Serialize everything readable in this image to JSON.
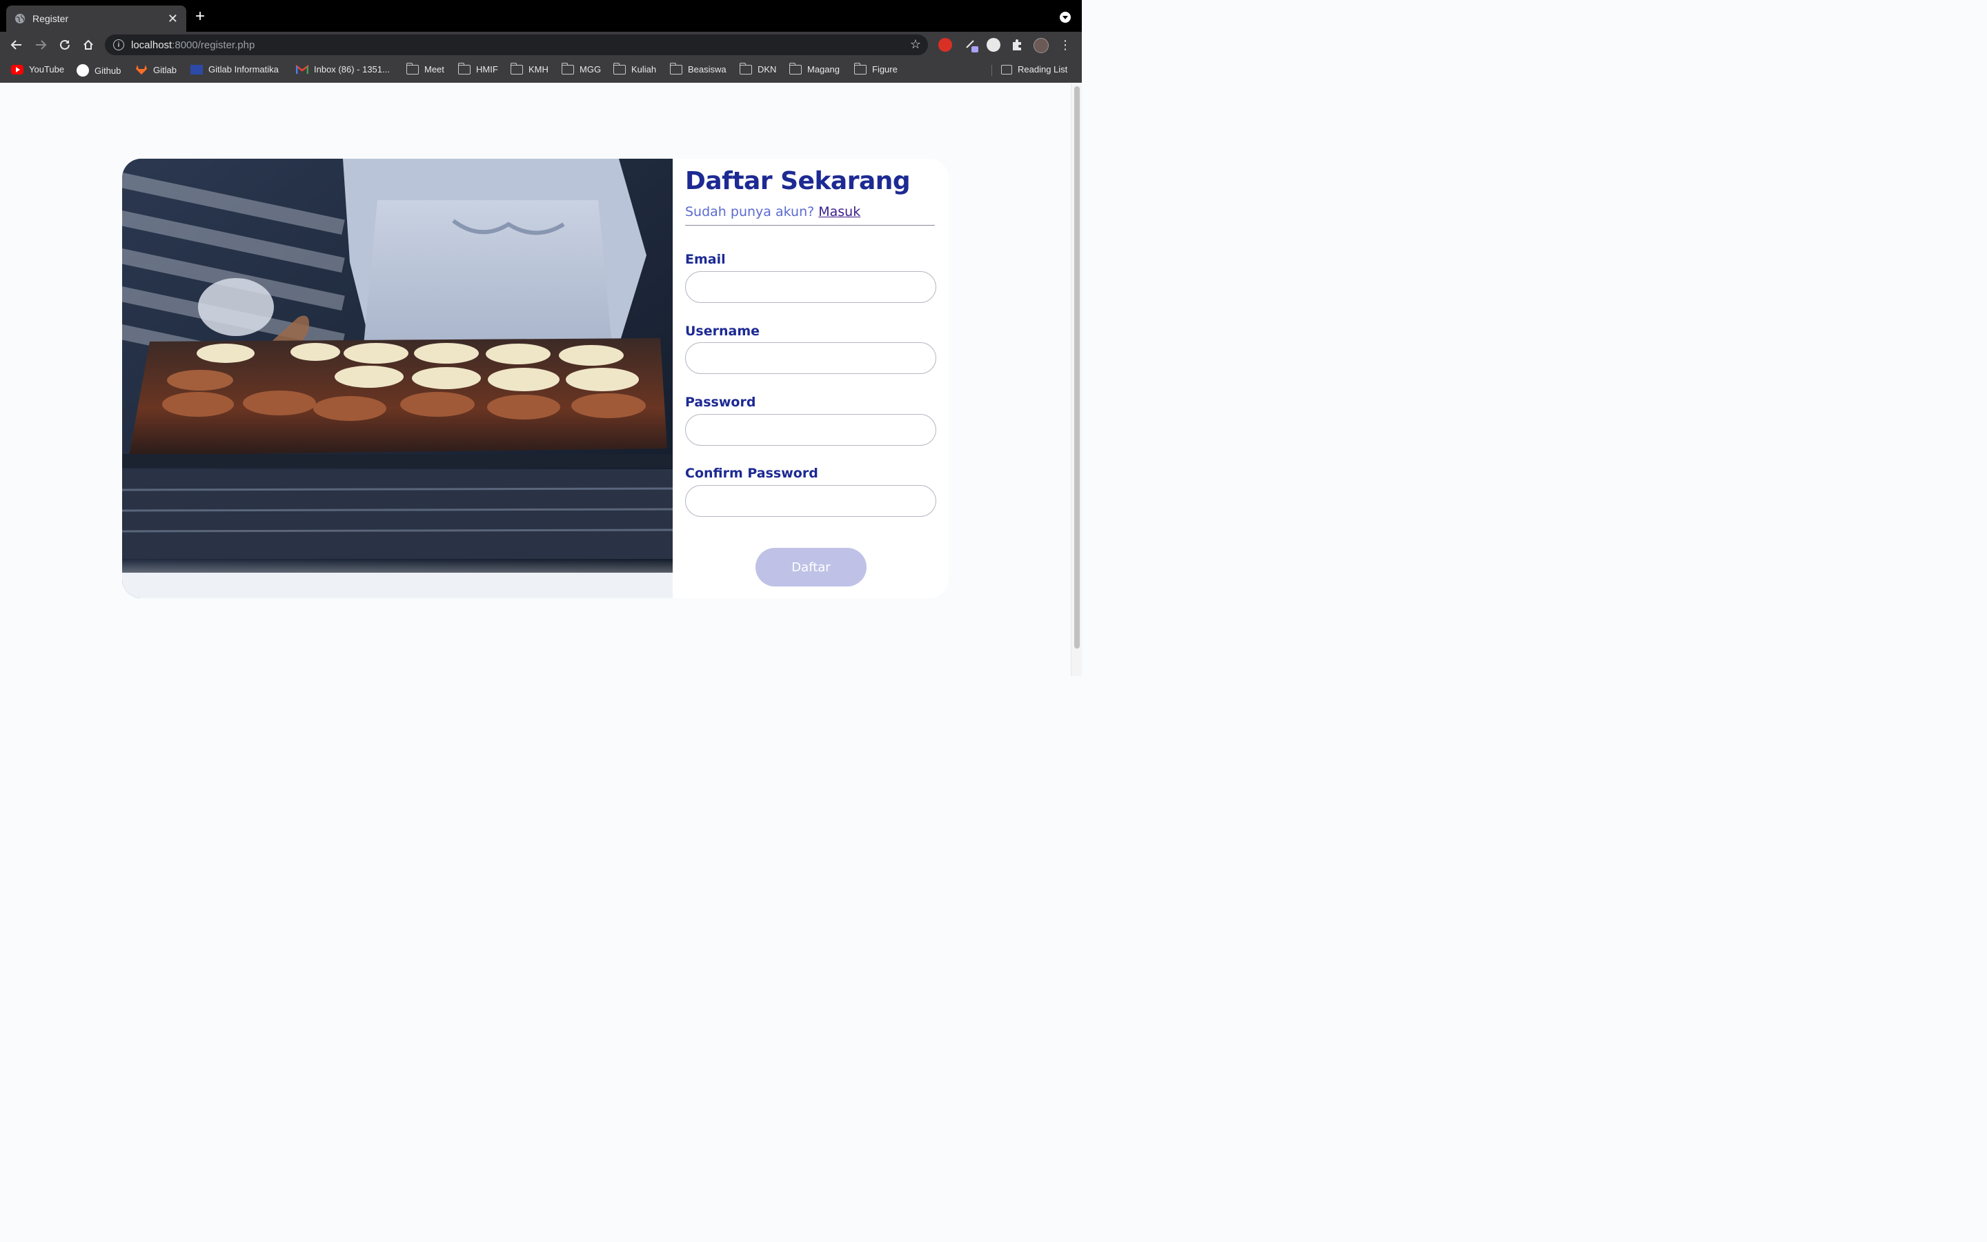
{
  "browser": {
    "tab_title": "Register",
    "url_host": "localhost",
    "url_rest": ":8000/register.php",
    "bookmarks": [
      {
        "label": "YouTube",
        "icon": "youtube-icon"
      },
      {
        "label": "Github",
        "icon": "github-icon"
      },
      {
        "label": "Gitlab",
        "icon": "gitlab-icon"
      },
      {
        "label": "Gitlab Informatika",
        "icon": "gitlab-informatika-icon"
      },
      {
        "label": "Inbox (86) - 1351...",
        "icon": "gmail-icon"
      },
      {
        "label": "Meet",
        "icon": "folder-icon"
      },
      {
        "label": "HMIF",
        "icon": "folder-icon"
      },
      {
        "label": "KMH",
        "icon": "folder-icon"
      },
      {
        "label": "MGG",
        "icon": "folder-icon"
      },
      {
        "label": "Kuliah",
        "icon": "folder-icon"
      },
      {
        "label": "Beasiswa",
        "icon": "folder-icon"
      },
      {
        "label": "DKN",
        "icon": "folder-icon"
      },
      {
        "label": "Magang",
        "icon": "folder-icon"
      },
      {
        "label": "Figure",
        "icon": "folder-icon"
      }
    ],
    "reading_list": "Reading List"
  },
  "register": {
    "title": "Daftar Sekarang",
    "subtitle": "Sudah punya akun?",
    "login_link": "Masuk",
    "fields": {
      "email": {
        "label": "Email",
        "value": ""
      },
      "username": {
        "label": "Username",
        "value": ""
      },
      "password": {
        "label": "Password",
        "value": ""
      },
      "confirm_password": {
        "label": "Confirm Password",
        "value": ""
      }
    },
    "submit_label": "Daftar"
  },
  "colors": {
    "primary": "#1d2a93",
    "subtitle": "#5b6bd0",
    "button_disabled": "#bfc2e6",
    "page_bg": "#fafbfd"
  }
}
